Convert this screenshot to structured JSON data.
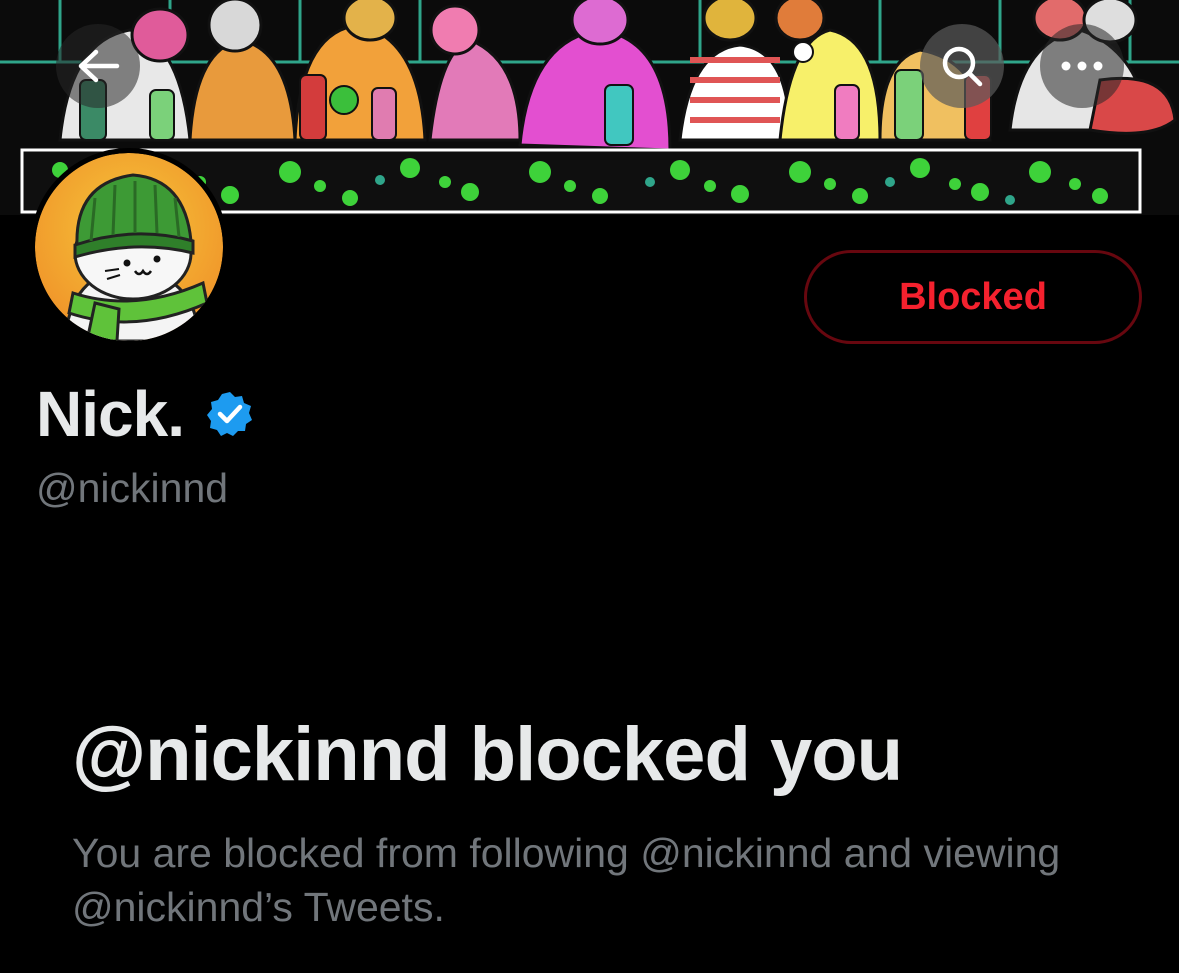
{
  "profile": {
    "display_name": "Nick.",
    "handle": "@nickinnd",
    "verified": true
  },
  "actions": {
    "blocked_label": "Blocked"
  },
  "blocked_notice": {
    "title": "@nickinnd blocked you",
    "description": "You are blocked from following @nickinnd and viewing @nickinnd’s Tweets."
  },
  "icons": {
    "back": "back-arrow-icon",
    "search": "search-icon",
    "more": "more-options-icon",
    "verified": "verified-badge-icon"
  },
  "colors": {
    "background": "#000000",
    "primary_text": "#e7e9ea",
    "secondary_text": "#71767b",
    "blocked_red": "#f4212e",
    "verified_blue": "#1d9bf0"
  }
}
